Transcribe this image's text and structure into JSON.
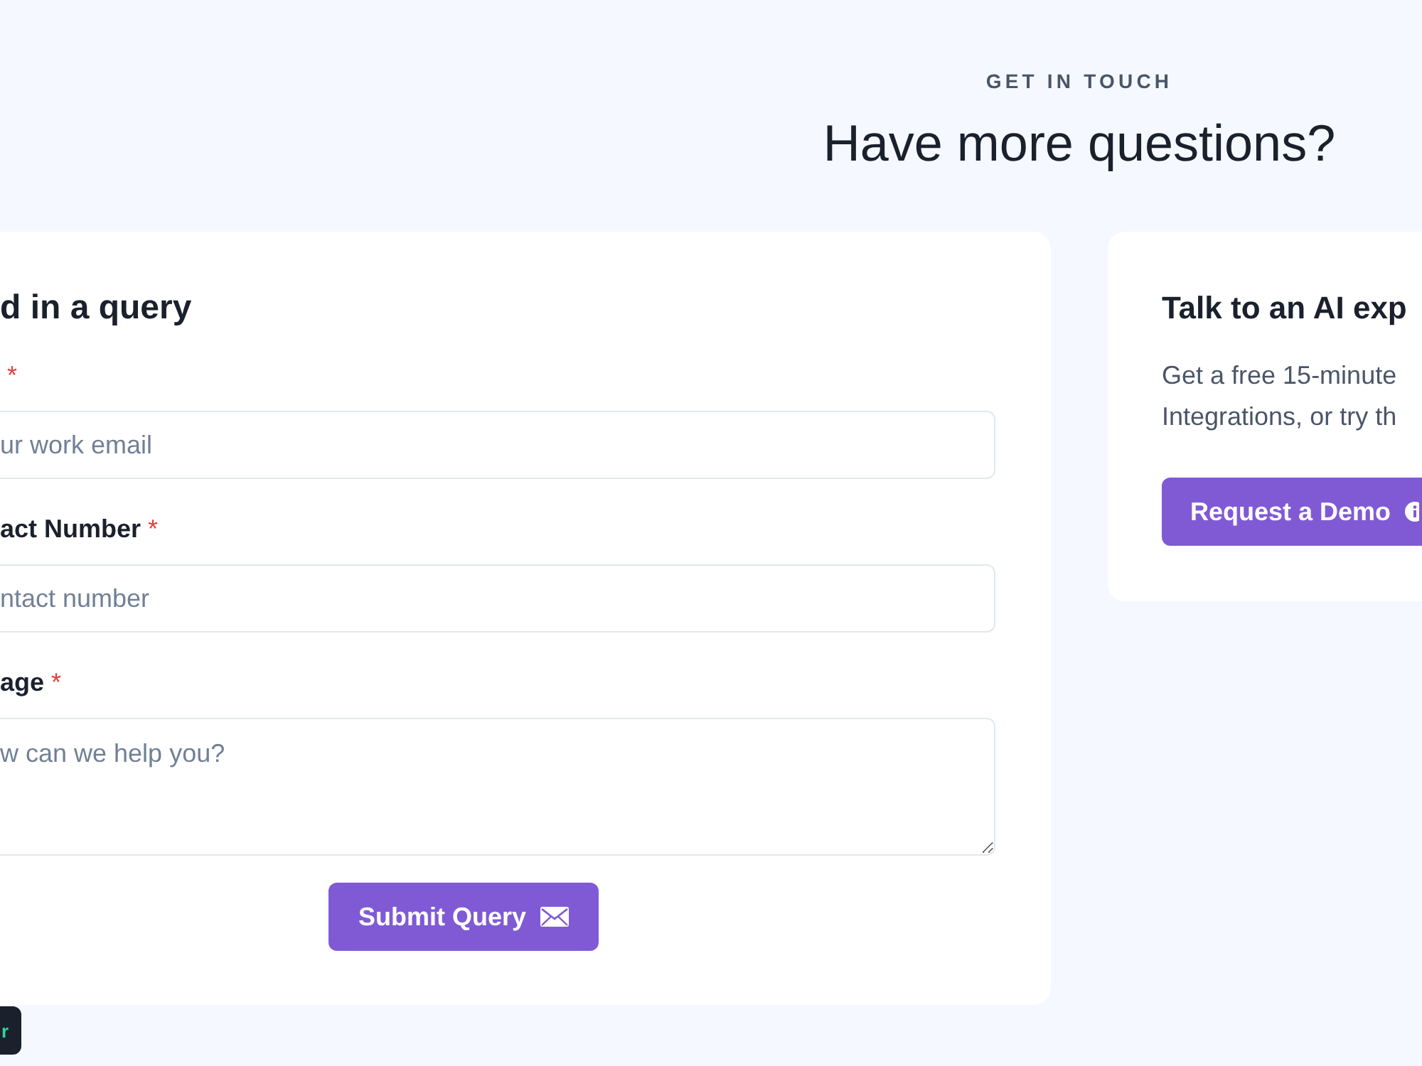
{
  "header": {
    "eyebrow": "GET IN TOUCH",
    "title": "Have more questions?"
  },
  "query_form": {
    "title": "d in a query",
    "fields": [
      {
        "kind": "input",
        "required_mark": "*",
        "placeholder": "ur work email"
      },
      {
        "kind": "input",
        "label": "act Number",
        "required_mark": "*",
        "placeholder": "ntact number"
      },
      {
        "kind": "textarea",
        "label": "age",
        "required_mark": "*",
        "placeholder": "w can we help you?"
      }
    ],
    "submit_button": {
      "label": "Submit Query"
    }
  },
  "expert_card": {
    "title": "Talk to an AI exp",
    "description_lines": [
      "Get a free 15-minute",
      "Integrations, or try th"
    ],
    "demo_button": {
      "label": "Request a Demo"
    }
  },
  "corner_badge": {
    "text": "r"
  }
}
